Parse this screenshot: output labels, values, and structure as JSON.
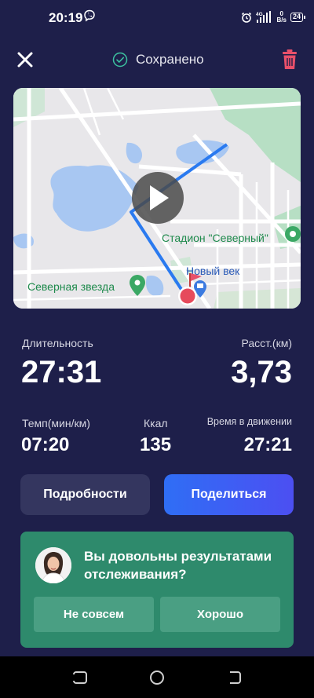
{
  "status_bar": {
    "time": "20:19",
    "net_speed_value": "0",
    "net_speed_unit": "B/s",
    "network": "4G",
    "battery": "24"
  },
  "header": {
    "saved_label": "Сохранено"
  },
  "map": {
    "stadium_label": "Стадион \"Северный\"",
    "new_century_label": "Новый век",
    "north_star_label": "Северная звезда"
  },
  "stats": {
    "duration_label": "Длительность",
    "duration_value": "27:31",
    "distance_label": "Расст.(км)",
    "distance_value": "3,73",
    "pace_label": "Темп(мин/км)",
    "pace_value": "07:20",
    "kcal_label": "Ккал",
    "kcal_value": "135",
    "moving_time_label": "Время в движении",
    "moving_time_value": "27:21"
  },
  "actions": {
    "details_label": "Подробности",
    "share_label": "Поделиться"
  },
  "feedback": {
    "question": "Вы довольны результатами отслеживания?",
    "no_label": "Не совсем",
    "yes_label": "Хорошо"
  },
  "colors": {
    "background": "#1e1f4a",
    "accent_blue": "#2f6ef5",
    "feedback_green": "#2e8a6c",
    "delete_red": "#e8506a",
    "saved_check": "#3cc2a0"
  }
}
